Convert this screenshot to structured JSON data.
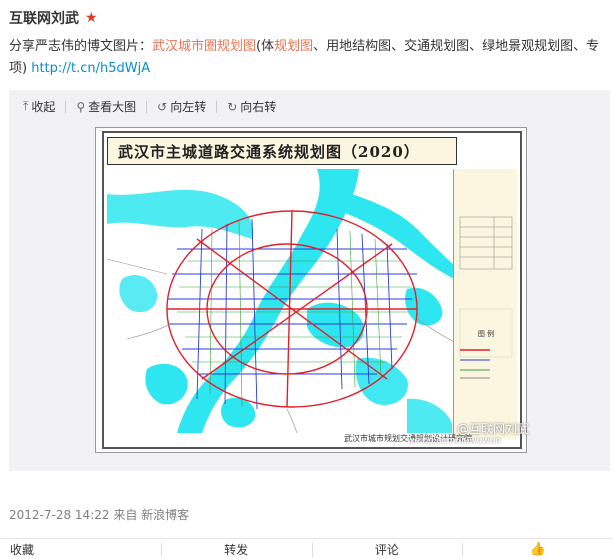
{
  "post": {
    "author": "互联网刘武",
    "content": {
      "prefix": "分享严志伟的博文图片：",
      "highlight1": "武汉城市圈规划图",
      "middle1": "(体",
      "highlight2": "规划图",
      "middle2": "、用地结构图、交通规划图、绿地景观规划图、专项) ",
      "link": "http://t.cn/h5dWjA"
    },
    "meta": "2012-7-28 14:22 来自 新浪博客"
  },
  "media": {
    "toolbar": {
      "collapse": "收起",
      "view_large": "查看大图",
      "rotate_left": "向左转",
      "rotate_right": "向右转"
    },
    "map": {
      "title": "武汉市主城道路交通系统规划图（2020）",
      "legend_title": "图 例",
      "footer": "武汉市城市规划交通规划设计研究院",
      "watermark": "@互联网刘武",
      "watermark_url": "weibo.com/liuwuwuo"
    }
  },
  "actions": {
    "favorite": "收藏",
    "repost": "转发",
    "comment": "评论"
  },
  "colors": {
    "highlight": "#eb7350",
    "link": "#0a8cd2",
    "water": "#2ee6f0",
    "road_main": "#e0202a",
    "road_secondary": "#2a3cd8",
    "road_local": "#3aa03a"
  }
}
